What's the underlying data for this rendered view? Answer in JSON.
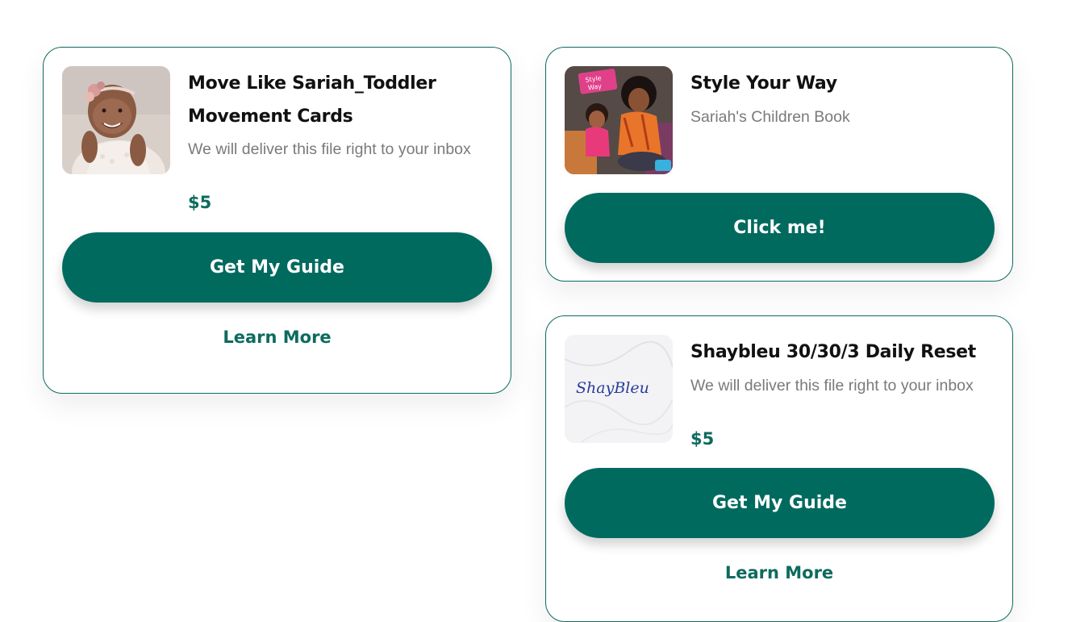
{
  "products": [
    {
      "title": "Move Like Sariah_Toddler Movement Cards",
      "description": "We will deliver this file right to your inbox",
      "price": "$5",
      "button_label": "Get My Guide",
      "link_label": "Learn More",
      "image": "baby-photo"
    },
    {
      "title": "Style Your Way",
      "subtitle": "Sariah's Children Book",
      "button_label": "Click me!",
      "image": "book-cover",
      "image_text": "Style Your Way"
    },
    {
      "title": "Shaybleu 30/30/3 Daily Reset",
      "description": "We will deliver this file right to your inbox",
      "price": "$5",
      "button_label": "Get My Guide",
      "link_label": "Learn More",
      "image": "marble-logo",
      "image_text": "ShayBleu"
    }
  ],
  "colors": {
    "accent": "#016a5f",
    "border": "#0e6b5e",
    "title": "#111111",
    "muted": "#7a7a7a"
  }
}
